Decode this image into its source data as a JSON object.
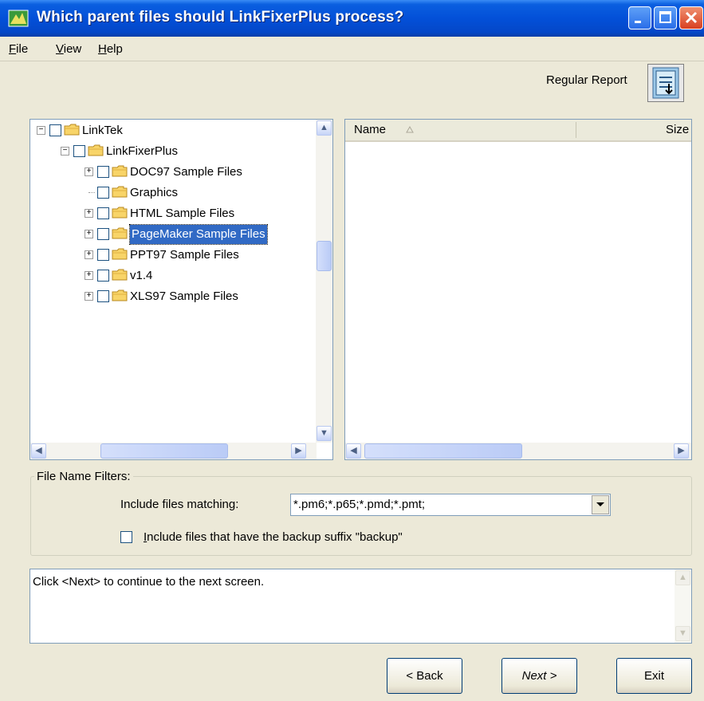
{
  "window": {
    "title": "Which parent files should LinkFixerPlus process?"
  },
  "menu": [
    {
      "label": "File",
      "accel": "F",
      "rest": "ile"
    },
    {
      "label": "View",
      "accel": "V",
      "rest": "iew"
    },
    {
      "label": "Help",
      "accel": "H",
      "rest": "elp"
    }
  ],
  "report": {
    "label": "Regular Report"
  },
  "tree": {
    "items": [
      {
        "label": "LinkTek",
        "expander": "−",
        "level": 0,
        "selected": false
      },
      {
        "label": "LinkFixerPlus",
        "expander": "−",
        "level": 1,
        "selected": false
      },
      {
        "label": "DOC97 Sample Files",
        "expander": "+",
        "level": 2,
        "selected": false
      },
      {
        "label": "Graphics",
        "expander": "",
        "level": 2,
        "selected": false
      },
      {
        "label": "HTML Sample Files",
        "expander": "+",
        "level": 2,
        "selected": false
      },
      {
        "label": "PageMaker Sample Files",
        "expander": "+",
        "level": 2,
        "selected": true
      },
      {
        "label": "PPT97 Sample Files",
        "expander": "+",
        "level": 2,
        "selected": false
      },
      {
        "label": "v1.4",
        "expander": "+",
        "level": 2,
        "selected": false
      },
      {
        "label": "XLS97 Sample Files",
        "expander": "+",
        "level": 2,
        "selected": false
      }
    ]
  },
  "list": {
    "columns": {
      "name": "Name",
      "size": "Size"
    }
  },
  "filters": {
    "legend": "File Name Filters:",
    "include_label": "Include files matching:",
    "include_value": "*.pm6;*.p65;*.pmd;*.pmt;",
    "backup_label": "Include files that have the backup suffix \"backup\"",
    "backup_checked": false
  },
  "info": {
    "text": "Click <Next> to continue to the next screen."
  },
  "buttons": {
    "back": "< Back",
    "next": "Next >",
    "exit": "Exit"
  }
}
